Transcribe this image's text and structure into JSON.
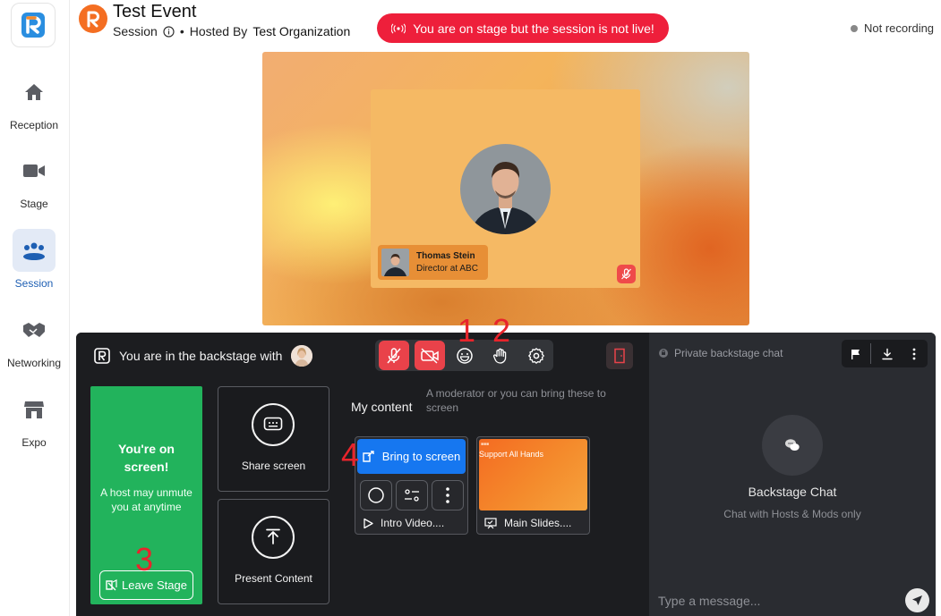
{
  "sidebar": {
    "items": [
      {
        "label": "Reception",
        "icon": "home-icon"
      },
      {
        "label": "Stage",
        "icon": "video-camera-icon"
      },
      {
        "label": "Session",
        "icon": "people-icon",
        "active": true
      },
      {
        "label": "Networking",
        "icon": "handshake-icon"
      },
      {
        "label": "Expo",
        "icon": "store-icon"
      }
    ]
  },
  "header": {
    "title": "Test Event",
    "session_label": "Session",
    "separator": "•",
    "hosted_by_label": "Hosted By",
    "organization": "Test Organization",
    "live_alert": "You are on stage but the session is not live!",
    "recording_status": "Not recording"
  },
  "stage": {
    "speaker_name": "Thomas Stein",
    "speaker_role": "Director at ABC"
  },
  "backstage": {
    "title": "You are in the backstage with",
    "on_screen_title": "You're on screen!",
    "on_screen_subtitle": "A host may unmute you at anytime",
    "leave_stage_label": "Leave Stage",
    "share_screen_label": "Share screen",
    "present_content_label": "Present Content",
    "my_content_label": "My content",
    "my_content_hint": "A moderator or you can bring these to screen",
    "bring_to_screen_label": "Bring to screen",
    "content_items": [
      {
        "label": "Intro Video....",
        "type": "video"
      },
      {
        "label": "Main Slides....",
        "type": "slides",
        "thumb_title": "Support All Hands"
      }
    ]
  },
  "chat": {
    "header": "Private backstage chat",
    "empty_title": "Backstage Chat",
    "empty_subtitle": "Chat with Hosts & Mods only",
    "input_placeholder": "Type a message..."
  },
  "annotations": {
    "marker_1": "1",
    "marker_2": "2",
    "marker_3": "3",
    "marker_4": "4"
  },
  "colors": {
    "accent_blue": "#1677f0",
    "live_red": "#ee1f3b",
    "on_screen_green": "#22b35c",
    "muted_red": "#e9424a",
    "brand_orange": "#f46e22"
  }
}
